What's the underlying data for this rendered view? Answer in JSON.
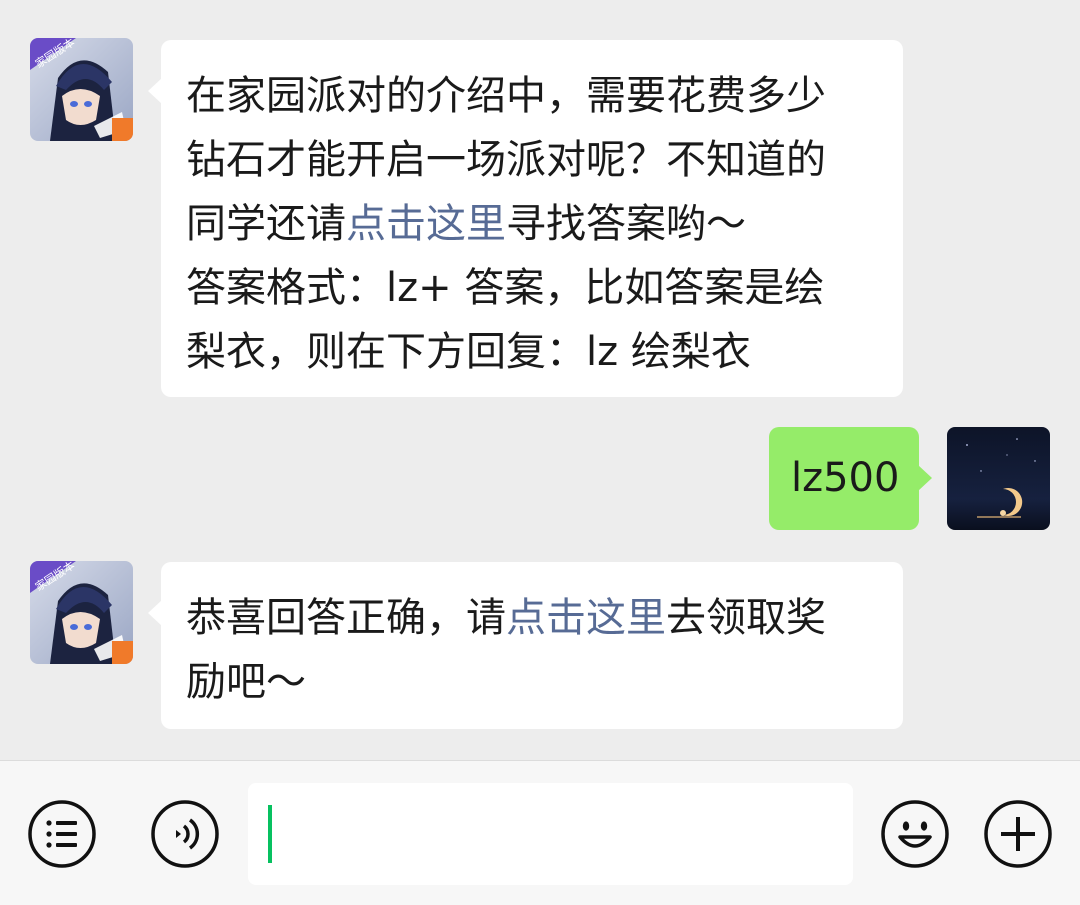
{
  "messages": [
    {
      "sender": "official-account",
      "avatar_icon": "game-character-avatar",
      "avatar_badge": "家园版本",
      "lines": [
        [
          {
            "text": "在家园派对的介绍中，需要花费多少",
            "link": false
          }
        ],
        [
          {
            "text": "钻石才能开启一场派对呢？不知道的",
            "link": false
          }
        ],
        [
          {
            "text": "同学还请",
            "link": false
          },
          {
            "text": "点击这里",
            "link": true
          },
          {
            "text": "寻找答案哟～",
            "link": false
          }
        ],
        [
          {
            "text": "答案格式：lz+ 答案，比如答案是绘",
            "link": false
          }
        ],
        [
          {
            "text": "梨衣，则在下方回复：lz 绘梨衣",
            "link": false
          }
        ]
      ]
    },
    {
      "sender": "me",
      "avatar_icon": "night-moon-avatar",
      "lines": [
        [
          {
            "text": "lz500",
            "link": false
          }
        ]
      ]
    },
    {
      "sender": "official-account",
      "avatar_icon": "game-character-avatar",
      "avatar_badge": "家园版本",
      "lines": [
        [
          {
            "text": "恭喜回答正确，请",
            "link": false
          },
          {
            "text": "点击这里",
            "link": true
          },
          {
            "text": "去领取奖",
            "link": false
          }
        ],
        [
          {
            "text": "励吧～",
            "link": false
          }
        ]
      ]
    }
  ],
  "input_bar": {
    "left_icons": [
      "menu-list-icon",
      "voice-icon"
    ],
    "right_icons": [
      "emoji-icon",
      "plus-icon"
    ],
    "input_value": "",
    "cursor_color": "#07c160"
  },
  "colors": {
    "background": "#ededed",
    "incoming_bubble": "#ffffff",
    "outgoing_bubble": "#95ec69",
    "link": "#576b95"
  }
}
